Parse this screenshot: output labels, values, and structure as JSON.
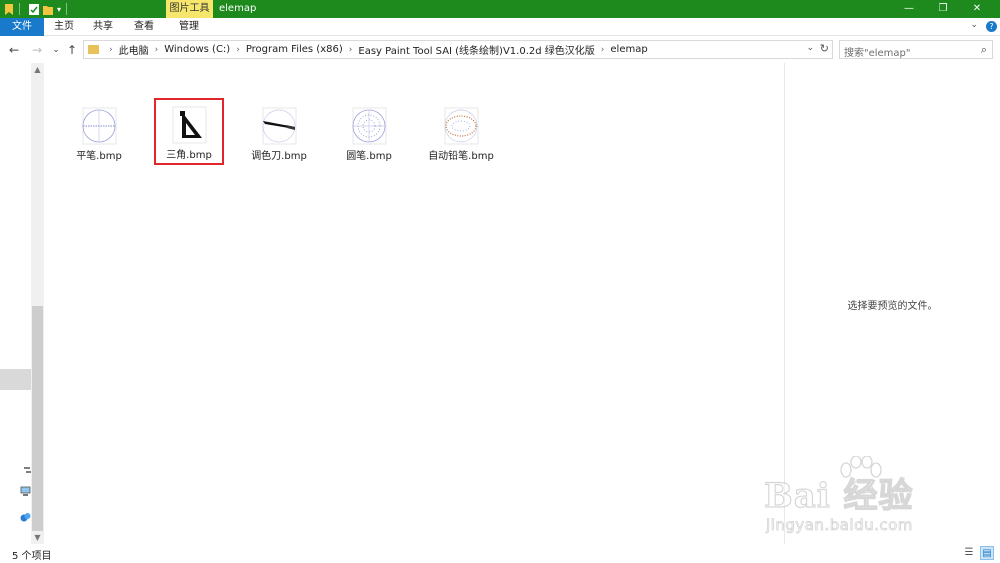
{
  "window": {
    "title": "elemap",
    "contextual_tab": "图片工具",
    "controls": {
      "minimize": "—",
      "restore": "❐",
      "close": "✕"
    }
  },
  "ribbon": {
    "tabs": [
      "文件",
      "主页",
      "共享",
      "查看",
      "管理"
    ],
    "collapse_icon": "⌄",
    "help": "?"
  },
  "nav": {
    "back": "←",
    "forward": "→",
    "recent": "⌄",
    "up": "↑"
  },
  "address": {
    "crumbs": [
      "此电脑",
      "Windows (C:)",
      "Program Files (x86)",
      "Easy Paint Tool SAI (线条绘制)V1.0.2d 绿色汉化版",
      "elemap"
    ],
    "separator": "›",
    "dropdown": "⌄",
    "refresh": "↻"
  },
  "search": {
    "placeholder": "搜索\"elemap\"",
    "icon": "⌕"
  },
  "files": [
    {
      "name": "平笔.bmp",
      "icon": "flat-brush-icon",
      "selected": false
    },
    {
      "name": "三角.bmp",
      "icon": "triangle-ruler-icon",
      "selected": true
    },
    {
      "name": "调色刀.bmp",
      "icon": "palette-knife-icon",
      "selected": false
    },
    {
      "name": "圆笔.bmp",
      "icon": "round-brush-icon",
      "selected": false
    },
    {
      "name": "自动铅笔.bmp",
      "icon": "auto-pencil-icon",
      "selected": false
    }
  ],
  "preview": {
    "empty_text": "选择要预览的文件。"
  },
  "status": {
    "item_count": "5 个项目"
  },
  "watermark": {
    "main": "Bai 经验",
    "sub": "jingyan.baidu.com"
  },
  "colors": {
    "titlebar": "#1e8a1e",
    "file_tab": "#1979ca",
    "contextual_tab": "#f6e76c",
    "selection_box": "#e0262a"
  }
}
